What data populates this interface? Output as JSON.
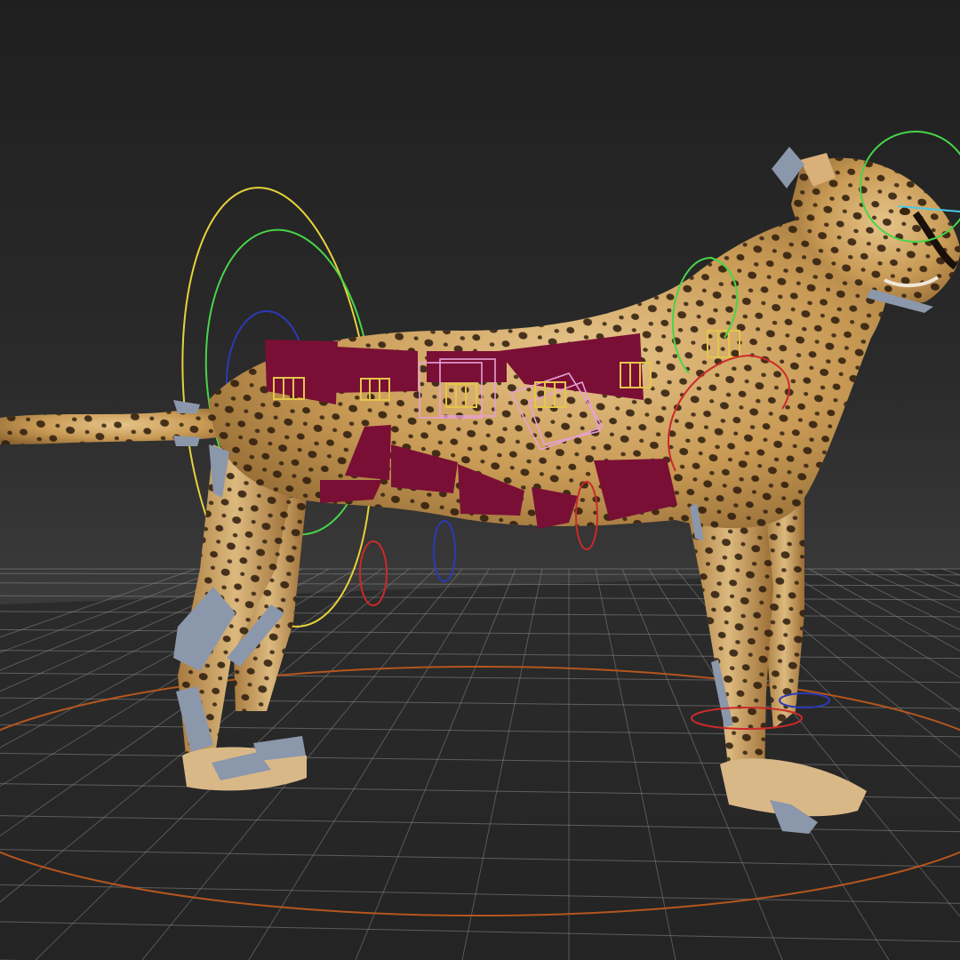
{
  "viewport": {
    "view": "perspective",
    "background_color": "#2b2b2b",
    "grid_color": "#8a8a8a",
    "grid_visible": true
  },
  "scene": {
    "model": "cheetah",
    "model_colors": {
      "fur": "#c89a55",
      "fur_light": "#e6c48a",
      "spots": "#2a1a0c"
    },
    "controls": [
      {
        "kind": "ellipse-control",
        "color": "#e5d23a"
      },
      {
        "kind": "ellipse-control",
        "color": "#48d548"
      },
      {
        "kind": "ellipse-control",
        "color": "#2b3ab8"
      },
      {
        "kind": "ellipse-control",
        "color": "#cc2a2a"
      },
      {
        "kind": "ground-circle",
        "color": "#b5561e"
      }
    ],
    "muscle_color": "#7a0f36",
    "bone_color": "#8b97aa",
    "helper_box_color": "#e8a0d8",
    "joint_marker_color": "#e5c64a"
  }
}
